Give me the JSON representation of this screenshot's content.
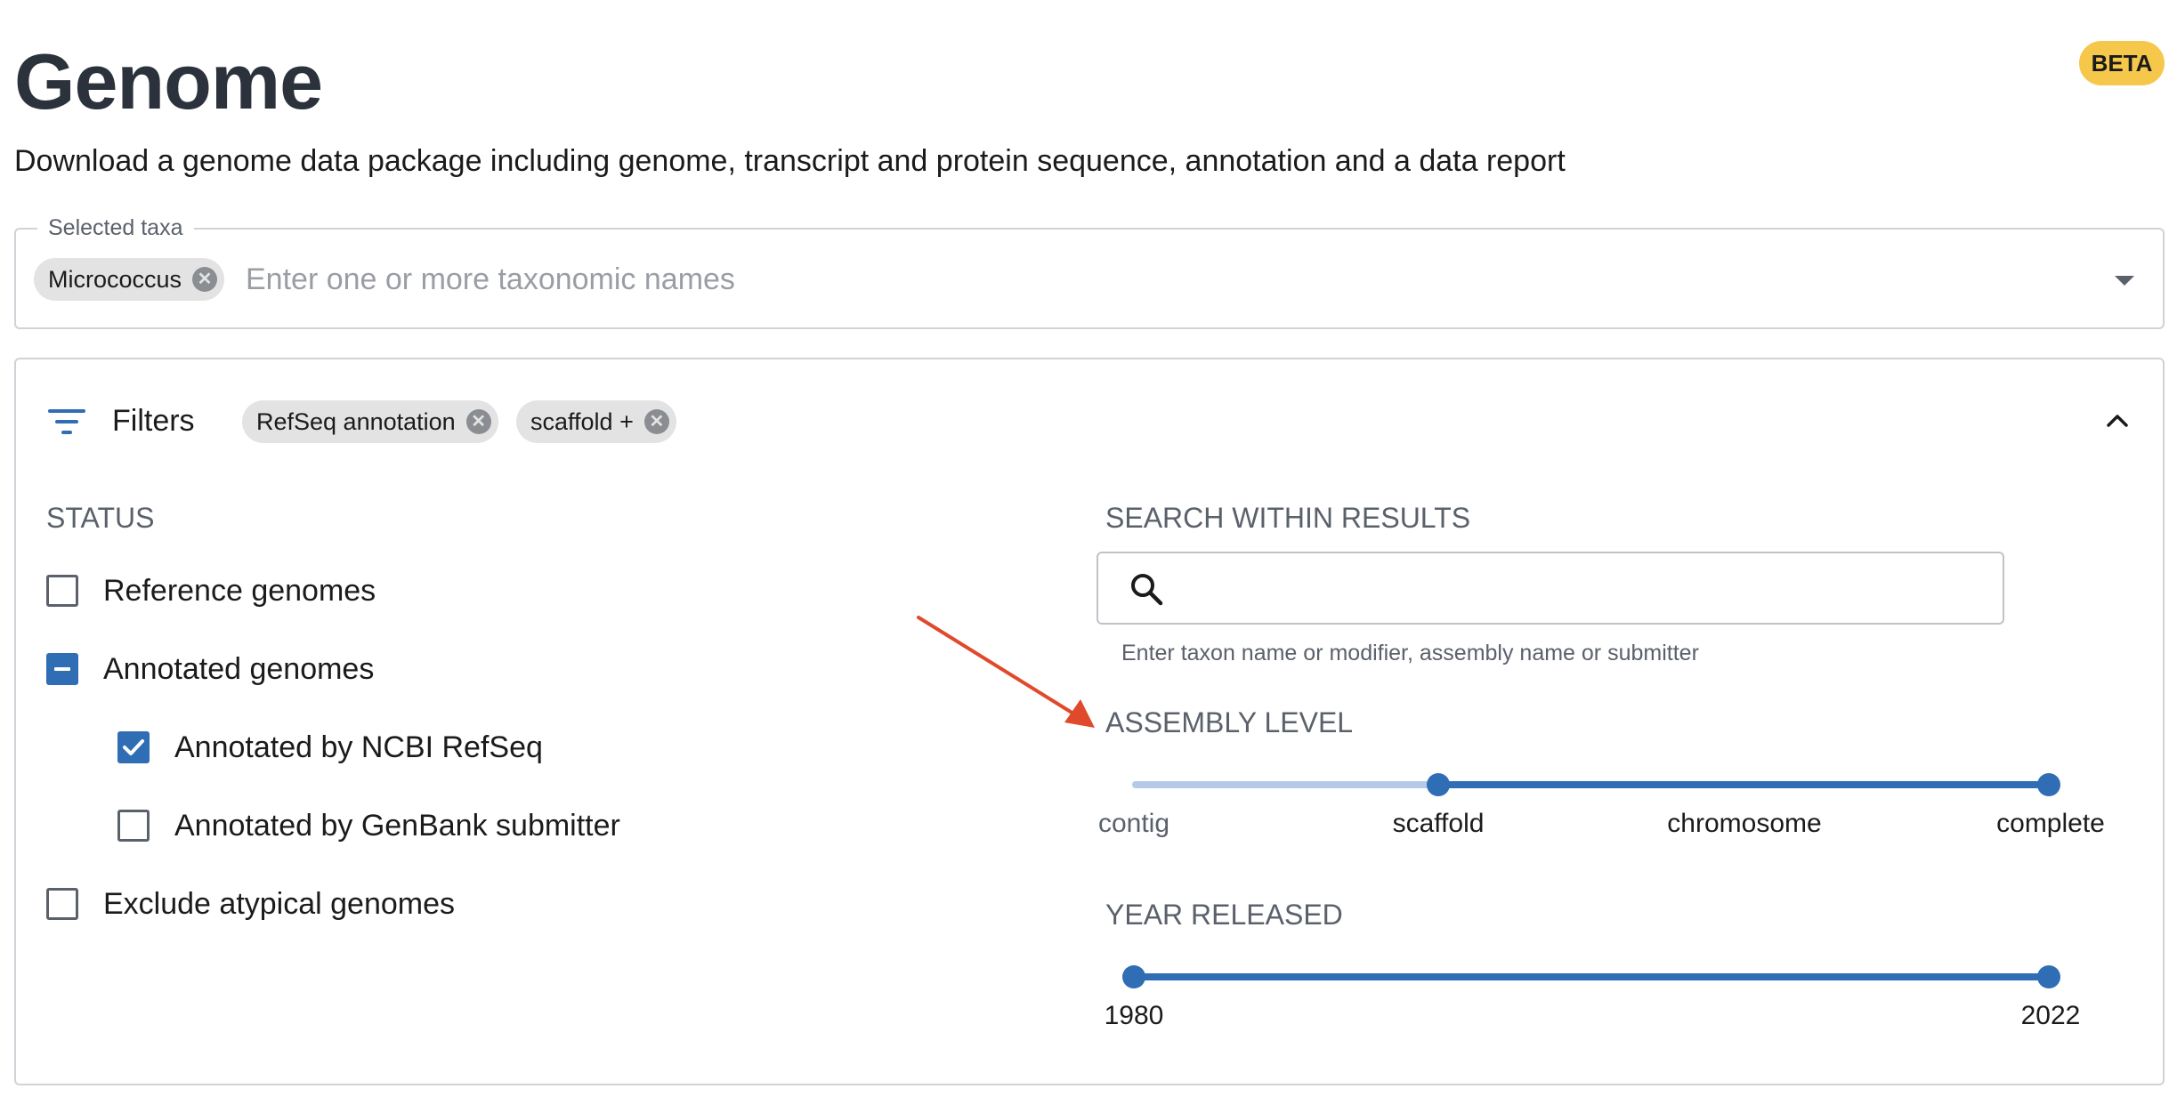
{
  "header": {
    "title": "Genome",
    "badge": "BETA",
    "subtitle": "Download a genome data package including genome, transcript and protein sequence, annotation and a data report"
  },
  "taxa": {
    "legend": "Selected taxa",
    "chips": [
      {
        "label": "Micrococcus"
      }
    ],
    "placeholder": "Enter one or more taxonomic names"
  },
  "filters": {
    "label": "Filters",
    "active_chips": [
      {
        "label": "RefSeq annotation"
      },
      {
        "label": "scaffold +"
      }
    ],
    "status": {
      "heading": "STATUS",
      "options": [
        {
          "label": "Reference genomes",
          "state": "unchecked"
        },
        {
          "label": "Annotated genomes",
          "state": "indeterminate"
        },
        {
          "label": "Annotated by NCBI RefSeq",
          "state": "checked"
        },
        {
          "label": "Annotated by GenBank submitter",
          "state": "unchecked"
        },
        {
          "label": "Exclude atypical genomes",
          "state": "unchecked"
        }
      ]
    },
    "search": {
      "heading": "SEARCH WITHIN RESULTS",
      "value": "",
      "placeholder": "",
      "hint": "Enter taxon name or modifier, assembly name or submitter"
    },
    "assembly_level": {
      "heading": "ASSEMBLY LEVEL",
      "levels": [
        "contig",
        "scaffold",
        "chromosome",
        "complete"
      ],
      "selected_min": "scaffold",
      "selected_max": "complete"
    },
    "year_released": {
      "heading": "YEAR RELEASED",
      "min_label": "1980",
      "max_label": "2022",
      "selected_min": 1980,
      "selected_max": 2022
    }
  },
  "colors": {
    "accent": "#2f6db5",
    "accent_light": "#b5c9e8",
    "badge": "#f5c84c",
    "annotation_arrow": "#e04a2c"
  }
}
